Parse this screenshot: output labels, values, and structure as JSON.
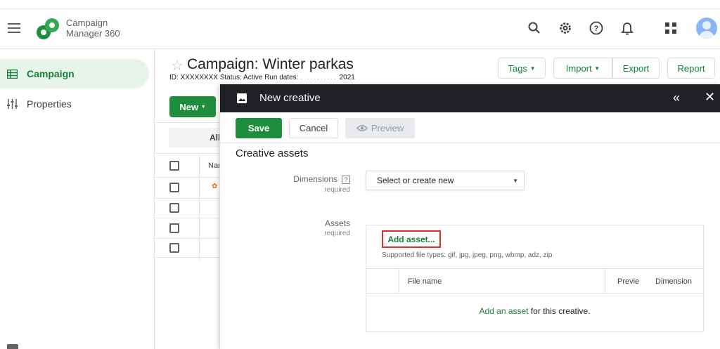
{
  "app": {
    "brand_line1": "Campaign",
    "brand_line2": "Manager 360"
  },
  "header_icons": [
    "search-icon",
    "settings-icon",
    "help-icon",
    "notifications-icon",
    "apps-icon",
    "account-avatar"
  ],
  "nav": {
    "items": [
      {
        "label": "Campaign",
        "icon": "table-icon",
        "active": true
      },
      {
        "label": "Properties",
        "icon": "tune-icon",
        "active": false
      }
    ]
  },
  "campaign": {
    "title": "Campaign: Winter parkas",
    "id_label": "ID: XXXXXXXX",
    "status_label": "Status: Active",
    "run_dates_label": "Run dates:",
    "run_dates_tail": "2021",
    "buttons": {
      "tags": "Tags",
      "import": "Import",
      "export": "Export",
      "report": "Report",
      "new": "New"
    },
    "filter_label": "All",
    "column_name": "Nar"
  },
  "panel": {
    "title": "New creative",
    "save": "Save",
    "cancel": "Cancel",
    "preview": "Preview",
    "section_title": "Creative assets",
    "dimensions": {
      "label": "Dimensions",
      "help": "?",
      "required": "required",
      "select_value": "Select or create new"
    },
    "assets": {
      "label": "Assets",
      "required": "required",
      "add_asset": "Add asset...",
      "supported": "Supported file types: gif, jpg, jpeg, png, wbmp, adz, zip",
      "columns": [
        "File name",
        "Previe",
        "Dimension"
      ],
      "empty_link": "Add an asset",
      "empty_rest": " for this creative."
    }
  },
  "colors": {
    "accent_green": "#1e8e3e",
    "link_green": "#188038",
    "panel_header": "#202124",
    "highlight_red": "#d93025"
  }
}
